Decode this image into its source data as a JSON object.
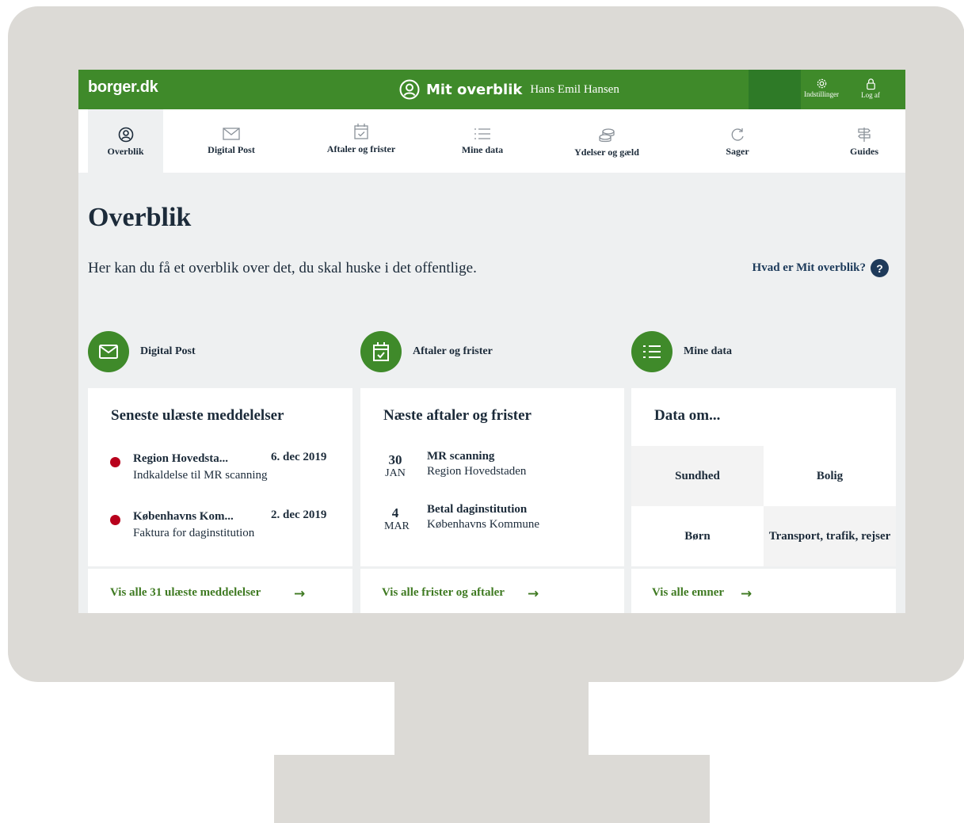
{
  "header": {
    "logo": "borger.dk",
    "title": "Mit overblik",
    "user_name": "Hans Emil Hansen",
    "settings_label": "Indstillinger",
    "logout_label": "Log af"
  },
  "nav": {
    "items": [
      {
        "label": "Overblik",
        "icon": "user-circle-icon",
        "active": true
      },
      {
        "label": "Digital Post",
        "icon": "envelope-icon"
      },
      {
        "label": "Aftaler og frister",
        "icon": "calendar-check-icon"
      },
      {
        "label": "Mine data",
        "icon": "list-icon"
      },
      {
        "label": "Ydelser og gæld",
        "icon": "coins-icon"
      },
      {
        "label": "Sager",
        "icon": "refresh-icon"
      },
      {
        "label": "Guides",
        "icon": "signpost-icon"
      }
    ]
  },
  "page": {
    "title": "Overblik",
    "intro": "Her kan du få et overblik over det, du skal huske i det offentlige.",
    "help_link": "Hvad er Mit overblik?",
    "help_icon": "?"
  },
  "sections": {
    "post": {
      "label": "Digital Post",
      "card_title": "Seneste ulæste meddelelser",
      "messages": [
        {
          "from": "Region Hovedsta...",
          "date": "6. dec 2019",
          "subject": "Indkaldelse til MR scanning"
        },
        {
          "from": "Københavns Kom...",
          "date": "2. dec 2019",
          "subject": "Faktura for daginstitution"
        }
      ],
      "link": "Vis alle 31 ulæste meddelelser",
      "arrow": "→"
    },
    "appointments": {
      "label": "Aftaler og frister",
      "card_title": "Næste aftaler og frister",
      "items": [
        {
          "day": "30",
          "month": "JAN",
          "title": "MR scanning",
          "sub": "Region Hovedstaden"
        },
        {
          "day": "4",
          "month": "MAR",
          "title": "Betal daginstitution",
          "sub": "Københavns Kommune"
        }
      ],
      "link": "Vis alle frister og aftaler",
      "arrow": "→"
    },
    "data": {
      "label": "Mine data",
      "card_title": "Data om...",
      "topics": [
        "Sundhed",
        "Bolig",
        "Børn",
        "Transport, trafik, rejser"
      ],
      "link": "Vis alle emner",
      "arrow": "→"
    }
  },
  "colors": {
    "brand_green": "#3f8a2a",
    "link_green": "#3f7a22",
    "unread_dot": "#b8001c",
    "text_dark": "#1c2b3a",
    "monitor_frame": "#dcdad6"
  }
}
